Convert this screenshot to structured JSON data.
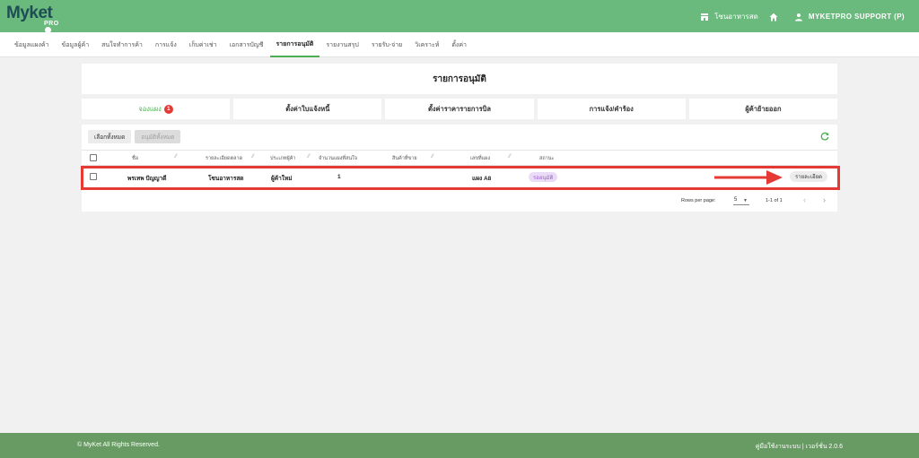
{
  "app": {
    "logo_text": "Myket",
    "logo_sub": "PRO"
  },
  "header": {
    "shop_name": "โซนอาหารสด",
    "user": "MYKETPRO SUPPORT (P)"
  },
  "nav": {
    "tabs": [
      {
        "label": "ข้อมูลแผงค้า"
      },
      {
        "label": "ข้อมูลผู้ค้า"
      },
      {
        "label": "สนใจทำการค้า"
      },
      {
        "label": "การแจ้ง"
      },
      {
        "label": "เก็บค่าเช่า"
      },
      {
        "label": "เอกสารบัญชี"
      },
      {
        "label": "รายการอนุมัติ"
      },
      {
        "label": "รายงานสรุป"
      },
      {
        "label": "รายรับ-จ่าย"
      },
      {
        "label": "วิเคราะห์"
      },
      {
        "label": "ตั้งค่า"
      }
    ],
    "active": "รายการอนุมัติ"
  },
  "page": {
    "title": "รายการอนุมัติ"
  },
  "subtabs": [
    {
      "label": "จองแผง",
      "badge": "1"
    },
    {
      "label": "ตั้งค่าใบแจ้งหนี้"
    },
    {
      "label": "ตั้งค่าราคารายการบิล"
    },
    {
      "label": "การแจ้ง/คำร้อง"
    },
    {
      "label": "ผู้ค้าย้ายออก"
    }
  ],
  "toolbar": {
    "select_all": "เลือกทั้งหมด",
    "approve_all": "อนุมัติทั้งหมด"
  },
  "table": {
    "columns": [
      "ชื่อ",
      "รายละเอียดตลาด",
      "ประเภทผู้ค้า",
      "จำนวนแผงที่สนใจ",
      "สินค้าที่ขาย",
      "เลขที่แผง",
      "สถานะ"
    ],
    "rows": [
      {
        "name": "พรเทพ ปัญญาดี",
        "market": "โซนอาหารสด",
        "vendor_type": "ผู้ค้าใหม่",
        "stall_count": "1",
        "product": "",
        "stall_no": "แผง A8",
        "status": "รออนุมัติ",
        "action": "รายละเอียด"
      }
    ]
  },
  "pagination": {
    "rows_per_page_label": "Rows per page:",
    "rows_per_page": "5",
    "range": "1-1 of 1"
  },
  "footer": {
    "copyright": "© MyKet All Rights Reserved.",
    "right": "คู่มือใช้งานระบบ | เวอร์ชั่น 2.0.6"
  },
  "colors": {
    "header_green": "#6aba7e",
    "footer_green": "#689b63",
    "accent_green": "#4caf50",
    "highlight_red": "#e53935",
    "status_purple": "#a05cd6"
  }
}
